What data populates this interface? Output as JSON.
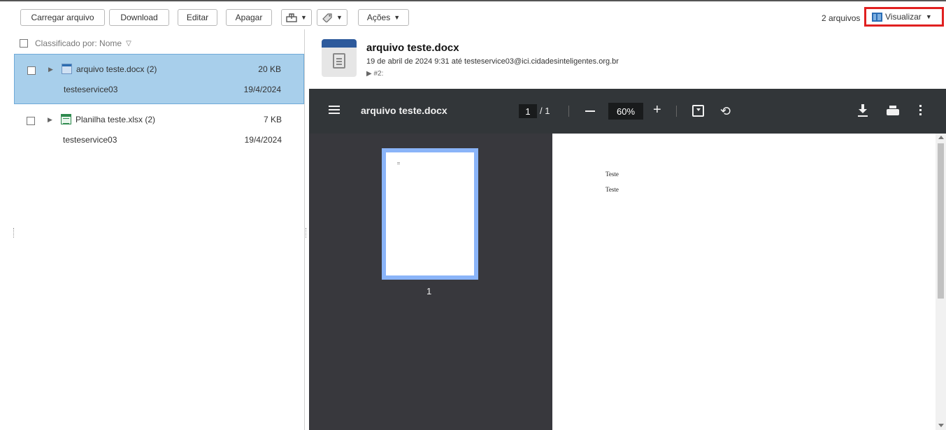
{
  "toolbar": {
    "upload_label": "Carregar arquivo",
    "download_label": "Download",
    "edit_label": "Editar",
    "delete_label": "Apagar",
    "actions_label": "Ações",
    "file_count": "2 arquivos",
    "view_label": "Visualizar"
  },
  "list": {
    "sort_label": "Classificado por: Nome",
    "files": [
      {
        "name": "arquivo teste.docx (2)",
        "size": "20 KB",
        "owner": "testeservice03",
        "date": "19/4/2024",
        "selected": true,
        "type": "docx"
      },
      {
        "name": "Planilha teste.xlsx (2)",
        "size": "7 KB",
        "owner": "testeservice03",
        "date": "19/4/2024",
        "selected": false,
        "type": "xlsx"
      }
    ]
  },
  "preview": {
    "title": "arquivo teste.docx",
    "meta": "19 de abril de 2024 9:31 até testeservice03@ici.cidadesinteligentes.org.br",
    "revision": "▶ #2:"
  },
  "viewer": {
    "title": "arquivo teste.docx",
    "current_page": "1",
    "total_pages": "/ 1",
    "zoom": "60%",
    "thumbnail_label": "1",
    "page_lines": [
      "Teste",
      "Teste"
    ]
  }
}
